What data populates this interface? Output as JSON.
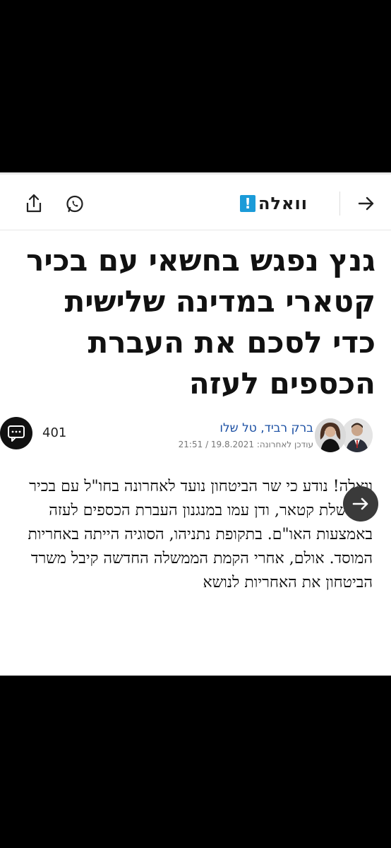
{
  "header": {
    "logo_badge": "!",
    "logo_text": "וואלה",
    "back_icon": "arrow-right-icon",
    "whatsapp_icon": "whatsapp-icon",
    "share_icon": "share-icon"
  },
  "article": {
    "title": "גנץ נפגש בחשאי עם בכיר קטארי במדינה שלישית כדי לסכם את העברת הכספים לעזה",
    "authors": "ברק רביד, טל שלו",
    "updated": "עודכן לאחרונה: 19.8.2021 / 21:51",
    "comments_count": "401",
    "body": "וואלה! נודע כי שר הביטחון נועד לאחרונה בחו\"ל עם בכיר בממשלת קטאר, ודן עמו במנגנון העברת הכספים לעזה באמצעות האו\"ם. בתקופת נתניהו, הסוגיה הייתה באחריות המוסד. אולם, אחרי הקמת הממשלה החדשה קיבל משרד הביטחון את האחריות לנושא"
  },
  "colors": {
    "brand": "#1b9bd8",
    "author_link": "#1b4fa3"
  }
}
